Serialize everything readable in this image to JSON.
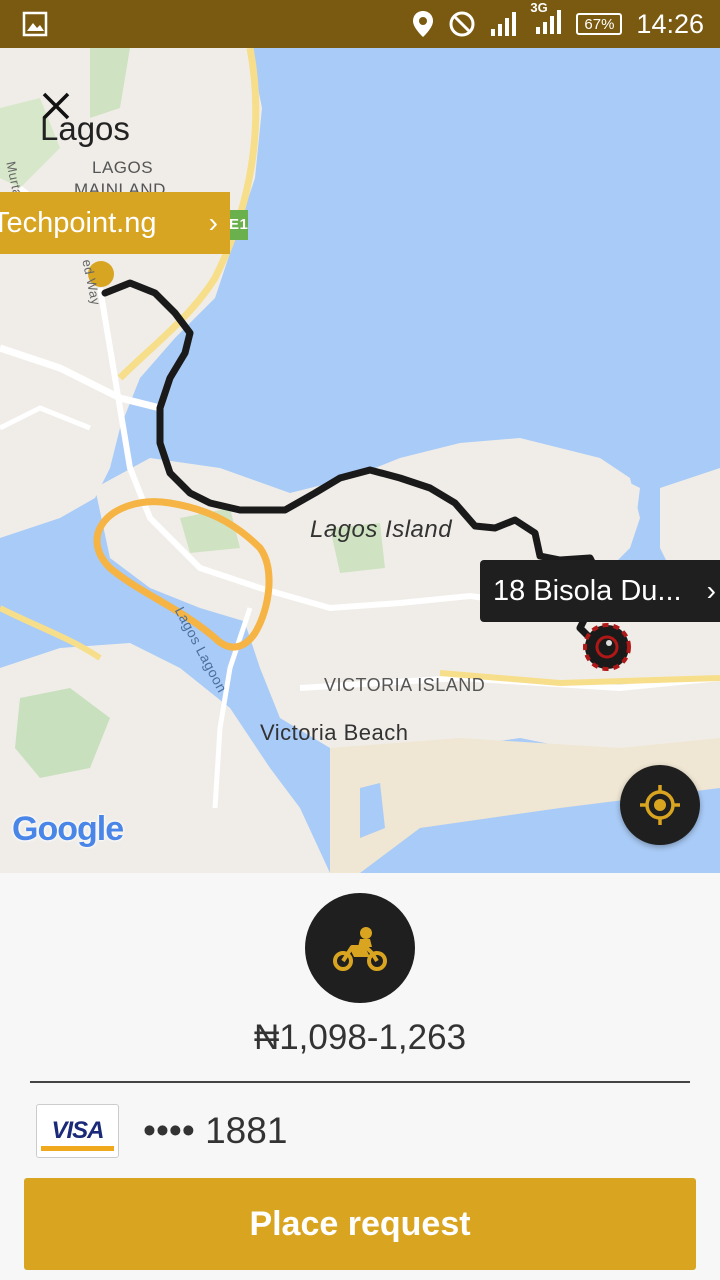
{
  "status_bar": {
    "time": "14:26",
    "battery": "67%",
    "network": "3G",
    "icons": [
      "image-icon",
      "location-icon",
      "do-not-disturb-icon",
      "signal-icon",
      "signal-3g-icon",
      "battery-icon"
    ]
  },
  "map": {
    "city": "Lagos",
    "labels": {
      "mainland": [
        "LAGOS",
        "MAINLAND"
      ],
      "murtala": "Murtala",
      "ahmed_way": "ed Way",
      "island": "Lagos Island",
      "lagoon": "Lagos Lagoon",
      "victoria_island": "VICTORIA ISLAND",
      "victoria_beach": "Victoria Beach",
      "highway": "E1"
    },
    "pickup": "Techpoint.ng",
    "destination": "18 Bisola Du...",
    "attribution": "Google",
    "colors": {
      "water": "#a9cbf7",
      "land": "#f0ede8",
      "route": "#1a1a1a",
      "highlight": "#f5b443",
      "pickup": "#d8a522"
    }
  },
  "panel": {
    "fare": "₦1,098-1,263",
    "vehicle": "motorcycle-icon",
    "payment": {
      "brand": "VISA",
      "masked_number": "•••• 1881"
    },
    "action": "Place request"
  }
}
